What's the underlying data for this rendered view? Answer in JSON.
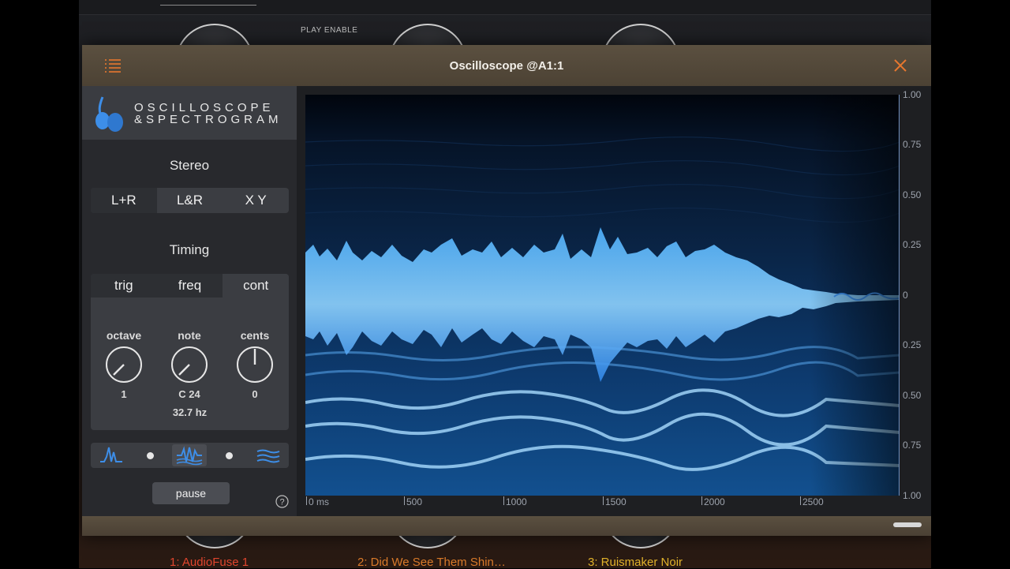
{
  "background": {
    "play_enable": "PLAY ENABLE",
    "tracks": [
      {
        "label": "1: AudioFuse 1",
        "color": "#e0452e"
      },
      {
        "label": "2: Did We See Them Shin…",
        "color": "#d97a2a"
      },
      {
        "label": "3: Ruismaker Noir",
        "color": "#e0b12a"
      }
    ]
  },
  "window": {
    "title": "Oscilloscope @A1:1",
    "accent": "#e8772e",
    "menu_icon": "list-icon",
    "close_icon": "close-icon"
  },
  "logo": {
    "line1": "OSCILLOSCOPE",
    "line2": "&SPECTROGRAM",
    "color": "#3d8ee8"
  },
  "stereo": {
    "label": "Stereo",
    "options": [
      "L+R",
      "L&R",
      "X Y"
    ],
    "selected": "L+R"
  },
  "timing": {
    "label": "Timing",
    "tabs": [
      "trig",
      "freq",
      "cont"
    ],
    "selected": "cont",
    "octave": {
      "label": "octave",
      "value": "1"
    },
    "note": {
      "label": "note",
      "value": "C 24"
    },
    "cents": {
      "label": "cents",
      "value": "0"
    },
    "frequency": "32.7 hz"
  },
  "modes": {
    "icons": [
      "oscilloscope-wave-icon",
      "combined-mode-icon",
      "spectrogram-icon"
    ],
    "selected": "combined-mode-icon",
    "color": "#3d8ee8"
  },
  "pause_label": "pause",
  "help_label": "?",
  "plot": {
    "y_labels": [
      "1.00",
      "0.75",
      "0.50",
      "0.25",
      "0",
      "0.25",
      "0.50",
      "0.75",
      "1.00"
    ],
    "x_labels": [
      "0 ms",
      "500",
      "1000",
      "1500",
      "2000",
      "2500"
    ]
  }
}
